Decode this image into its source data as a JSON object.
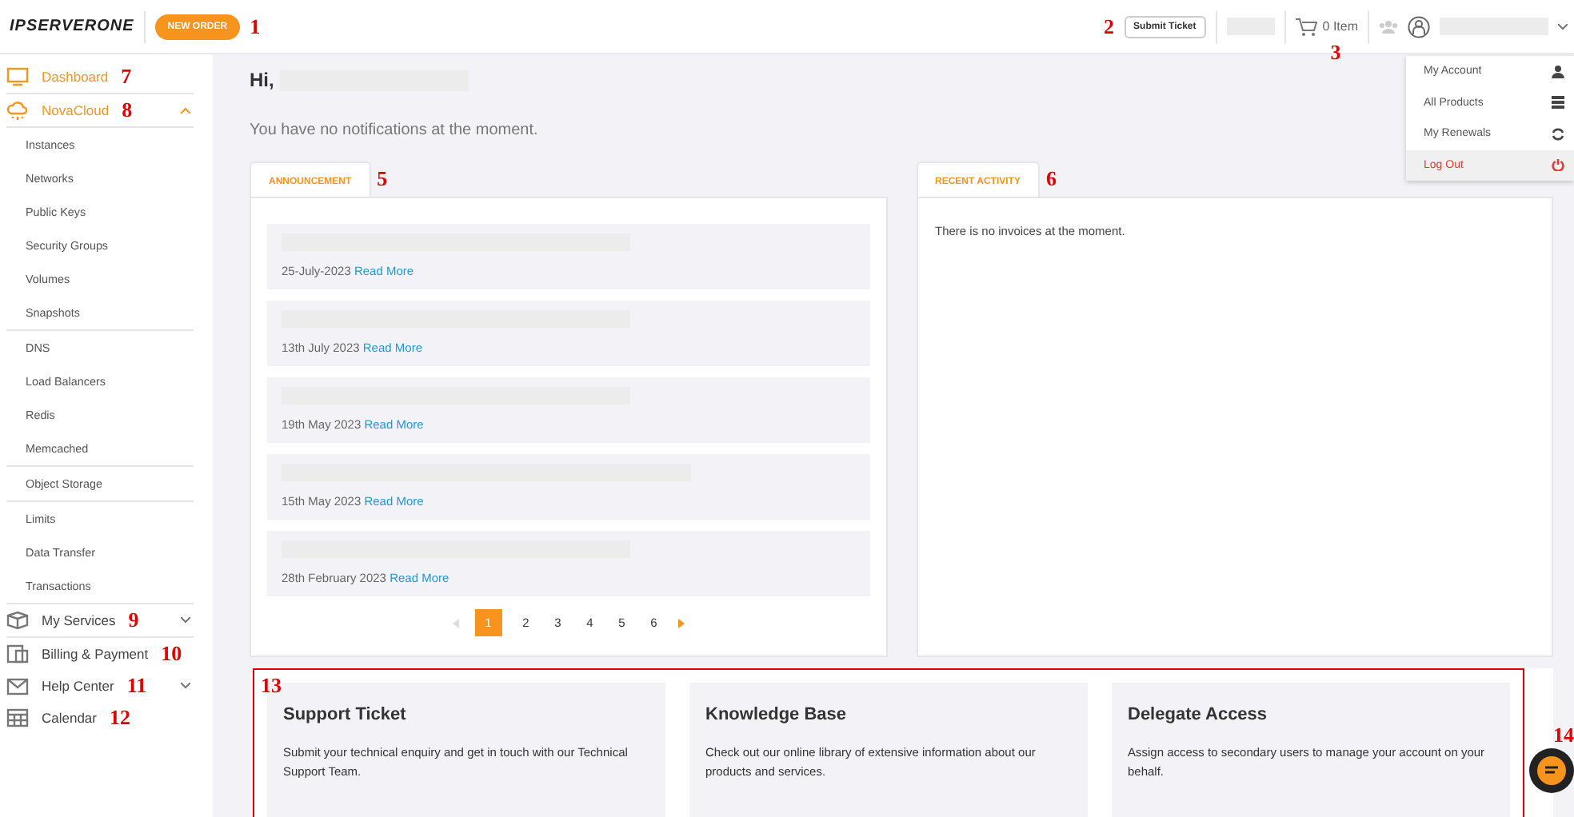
{
  "header": {
    "logo": "IPSERVERONE",
    "new_order": {
      "label": "NEW ORDER",
      "marker": "1"
    },
    "submit_ticket": {
      "label": "Submit Ticket",
      "marker": "2"
    },
    "cart": {
      "label": "0 Item",
      "marker": "3"
    }
  },
  "user_menu": [
    {
      "label": "My Account",
      "kind": "user",
      "danger": false,
      "highlighted": false
    },
    {
      "label": "All Products",
      "kind": "list",
      "danger": false,
      "highlighted": false
    },
    {
      "label": "My Renewals",
      "kind": "refresh",
      "danger": false,
      "highlighted": false
    },
    {
      "label": "Log Out",
      "kind": "power",
      "danger": true,
      "highlighted": true
    }
  ],
  "sidebar": [
    {
      "label": "Dashboard",
      "kind": "monitor",
      "active": true,
      "marker": "7"
    },
    {
      "label": "NovaCloud",
      "kind": "cloud",
      "active": true,
      "expanded": true,
      "marker": "8",
      "groups": [
        {
          "items": [
            "Instances",
            "Networks",
            "Public Keys",
            "Security Groups",
            "Volumes",
            "Snapshots"
          ]
        },
        {
          "items": [
            "DNS",
            "Load Balancers",
            "Redis",
            "Memcached"
          ]
        },
        {
          "items": [
            "Object Storage"
          ]
        },
        {
          "items": [
            "Limits",
            "Data Transfer",
            "Transactions"
          ]
        }
      ]
    },
    {
      "label": "My Services",
      "kind": "box",
      "active": false,
      "expanded": false,
      "marker": "9"
    },
    {
      "label": "Billing & Payment",
      "kind": "bill",
      "active": false,
      "marker": "10"
    },
    {
      "label": "Help Center",
      "kind": "mail",
      "active": false,
      "expanded": false,
      "marker": "11"
    },
    {
      "label": "Calendar",
      "kind": "calendar",
      "active": false,
      "marker": "12"
    }
  ],
  "greeting": "Hi,",
  "notification": "You have no notifications at the moment.",
  "announcement": {
    "tab": "ANNOUNCEMENT",
    "marker": "5",
    "items": [
      {
        "date": "25-July-2023",
        "link": "Read More"
      },
      {
        "date": "13th July 2023",
        "link": "Read More"
      },
      {
        "date": "19th May 2023",
        "link": "Read More"
      },
      {
        "date": "15th May 2023",
        "link": "Read More"
      },
      {
        "date": "28th February 2023",
        "link": "Read More"
      }
    ],
    "pages": [
      {
        "label": "1",
        "selected": true
      },
      {
        "label": "2",
        "selected": false
      },
      {
        "label": "3",
        "selected": false
      },
      {
        "label": "4",
        "selected": false
      },
      {
        "label": "5",
        "selected": false
      },
      {
        "label": "6",
        "selected": false
      }
    ]
  },
  "recent_activity": {
    "tab": "RECENT ACTIVITY",
    "marker": "6",
    "message": "There is no invoices at the moment."
  },
  "cards": {
    "marker": "13",
    "items": [
      {
        "title": "Support Ticket",
        "text": "Submit your technical enquiry and get in touch with our Technical Support Team."
      },
      {
        "title": "Knowledge Base",
        "text": "Check out our online library of extensive information about our products and services."
      },
      {
        "title": "Delegate Access",
        "text": "Assign access to secondary users to manage your account on your behalf."
      }
    ]
  },
  "chat": {
    "marker": "14"
  }
}
